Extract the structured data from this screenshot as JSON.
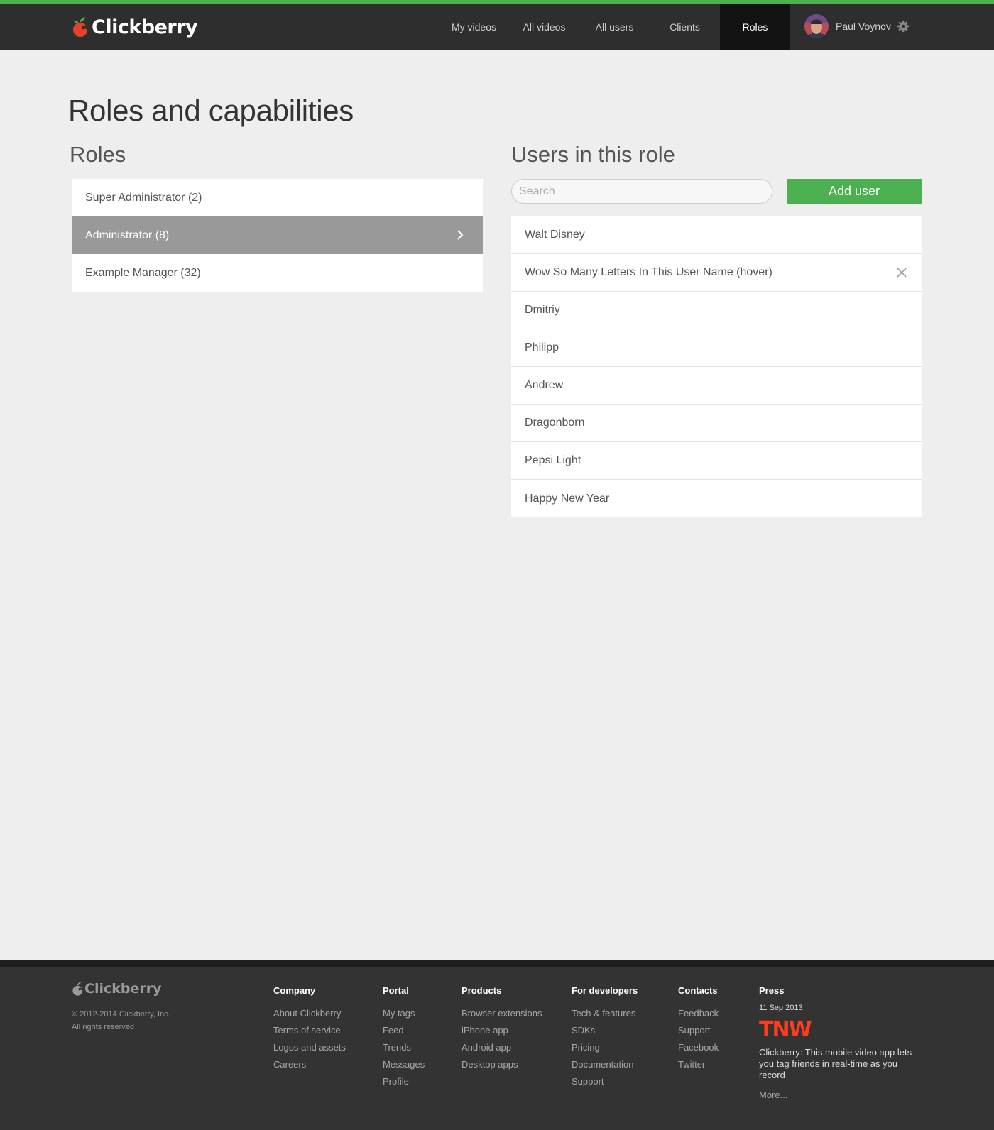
{
  "brand": {
    "name": "Clickberry",
    "accent": "#4caf50",
    "logo_red": "#e8402a"
  },
  "nav": {
    "items": [
      {
        "label": "My videos",
        "active": false
      },
      {
        "label": "All videos",
        "active": false
      },
      {
        "label": "All users",
        "active": false
      },
      {
        "label": "Clients",
        "active": false
      },
      {
        "label": "Roles",
        "active": true
      }
    ],
    "user": {
      "name": "Paul Voynov",
      "settings_icon": "gear-icon"
    }
  },
  "page": {
    "title": "Roles and capabilities"
  },
  "roles": {
    "title": "Roles",
    "items": [
      {
        "label": "Super Administrator (2)",
        "selected": false
      },
      {
        "label": "Administrator (8)",
        "selected": true
      },
      {
        "label": "Example Manager (32)",
        "selected": false
      }
    ]
  },
  "users": {
    "title": "Users in this role",
    "search": {
      "placeholder": "Search",
      "value": ""
    },
    "add_button": "Add user",
    "items": [
      {
        "name": "Walt Disney"
      },
      {
        "name": "Wow So Many Letters In This User Name (hover)",
        "hover": true
      },
      {
        "name": "Dmitriy"
      },
      {
        "name": "Philipp"
      },
      {
        "name": "Andrew"
      },
      {
        "name": "Dragonborn"
      },
      {
        "name": "Pepsi Light"
      },
      {
        "name": "Happy New Year"
      }
    ]
  },
  "footer": {
    "brand": "Clickberry",
    "copyright": "© 2012-2014 Clickberry, Inc.",
    "rights": "All rights reserved",
    "columns": [
      {
        "title": "Company",
        "links": [
          "About Clickberry",
          "Terms of service",
          "Logos and assets",
          "Careers"
        ]
      },
      {
        "title": "Portal",
        "links": [
          "My tags",
          "Feed",
          "Trends",
          "Messages",
          "Profile"
        ]
      },
      {
        "title": "Products",
        "links": [
          "Browser extensions",
          "iPhone app",
          "Android app",
          "Desktop apps"
        ]
      },
      {
        "title": "For developers",
        "links": [
          "Tech & features",
          "SDKs",
          "Pricing",
          "Documentation",
          "Support"
        ]
      },
      {
        "title": "Contacts",
        "links": [
          "Feedback",
          "Support",
          "Facebook",
          "Twitter"
        ]
      }
    ],
    "press": {
      "title": "Press",
      "date": "11 Sep 2013",
      "source": "TNW",
      "text": "Clickberry: This mobile video app lets you tag friends in real-time as you record",
      "more": "More..."
    }
  }
}
